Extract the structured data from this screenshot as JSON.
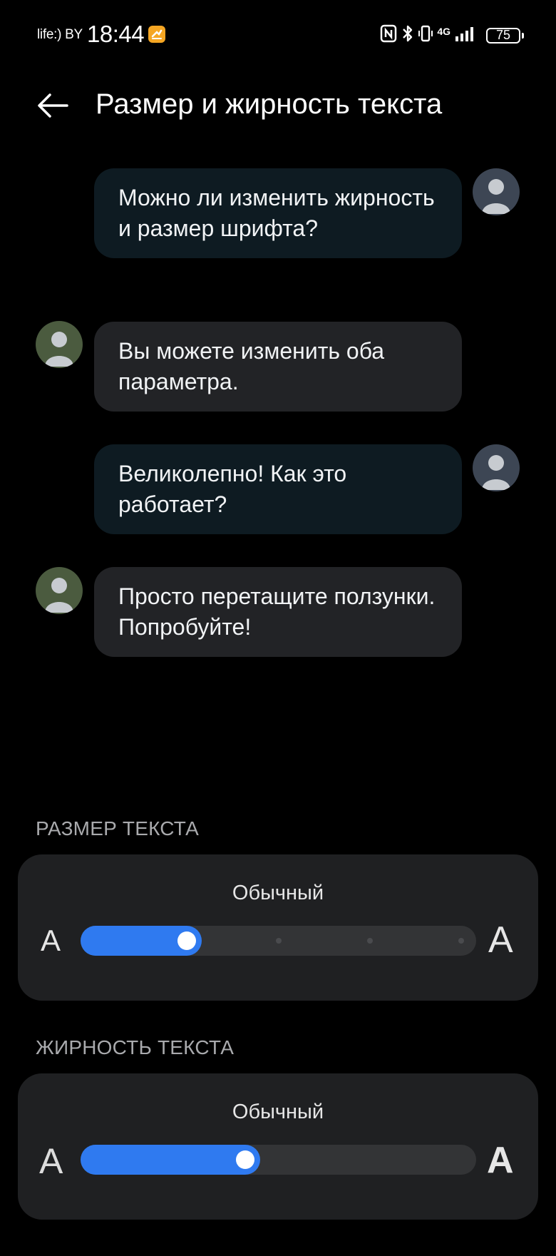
{
  "status_bar": {
    "carrier": "life:) BY",
    "time": "18:44",
    "network": "4G",
    "battery": "75",
    "icons": [
      "nfc-icon",
      "bluetooth-icon",
      "vibrate-icon",
      "signal-icon",
      "battery-icon"
    ]
  },
  "header": {
    "title": "Размер и жирность текста",
    "back_icon": "back-arrow-icon"
  },
  "chat": {
    "messages": [
      {
        "sender": "user",
        "text": "Можно ли изменить жирность и размер шрифта?"
      },
      {
        "sender": "assistant",
        "text": "Вы можете изменить оба параметра."
      },
      {
        "sender": "user",
        "text": "Великолепно! Как это работает?"
      },
      {
        "sender": "assistant",
        "text": "Просто перетащите ползунки. Попробуйте!"
      }
    ]
  },
  "text_size": {
    "label": "РАЗМЕР ТЕКСТА",
    "value": "Обычный",
    "small_glyph": "A",
    "large_glyph": "A",
    "level": 1,
    "steps": 5
  },
  "text_weight": {
    "label": "ЖИРНОСТЬ ТЕКСТА",
    "value": "Обычный",
    "small_glyph": "A",
    "large_glyph": "A",
    "fill_fraction": 0.41
  },
  "colors": {
    "background": "#000000",
    "accent": "#2f7af0",
    "user_bubble": "#0e1b22",
    "assistant_bubble": "#222326",
    "card": "#1f2022"
  }
}
